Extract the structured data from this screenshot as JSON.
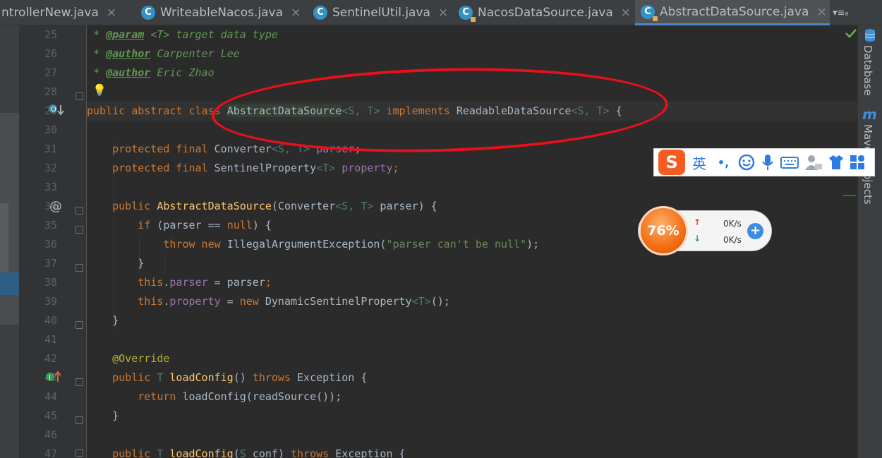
{
  "tabs": [
    {
      "label": "ntrollerNew.java",
      "icon": "",
      "close": "×"
    },
    {
      "label": "WriteableNacos.java",
      "icon": "C",
      "close": "×"
    },
    {
      "label": "SentinelUtil.java",
      "icon": "C",
      "close": "×"
    },
    {
      "label": "NacosDataSource.java",
      "icon": "C",
      "close": "×"
    },
    {
      "label": "AbstractDataSource.java",
      "icon": "C",
      "close": "×"
    }
  ],
  "tab_overflow": "▾≡₆",
  "line_numbers": [
    "25",
    "26",
    "27",
    "28",
    "29",
    "30",
    "31",
    "32",
    "33",
    "34",
    "35",
    "36",
    "37",
    "38",
    "39",
    "40",
    "41",
    "42",
    "43",
    "44",
    "45",
    "46",
    "47"
  ],
  "right_tools": {
    "database": "Database",
    "maven": "Maven Projects",
    "maven_icon": "m"
  },
  "ime": {
    "logo": "S",
    "lang": "英",
    "punct": "•,"
  },
  "speed": {
    "percent": "76%",
    "up": "0K/s",
    "down": "0K/s",
    "up_arrow": "↑",
    "down_arrow": "↓",
    "plus": "+"
  },
  "gutter_icons": {
    "bulb": "💡",
    "override_at": "@"
  },
  "colors": {
    "keyword": "#cc7832",
    "field": "#9876aa",
    "function": "#ffc66d",
    "string": "#6a8759",
    "doc": "#629755",
    "annotation": "#bbb529",
    "annotation_ring": "#e8101a",
    "ime_brand": "#f55b23"
  },
  "code": {
    "l25": {
      "p": " * ",
      "tag": "@param",
      "rest": " <T> target data type"
    },
    "l26": {
      "p": " * ",
      "tag": "@author",
      "rest": " Carpenter Lee"
    },
    "l27": {
      "p": " * ",
      "tag": "@author",
      "rest": " Eric Zhao"
    },
    "l29": {
      "k1": "public abstract class ",
      "name": "AbstractDataSource",
      "g1": "<S, T>",
      "k2": " implements ",
      "iface": "ReadableDataSource",
      "g2": "<S, T>",
      "end": " {"
    },
    "l31": {
      "k": "    protected final ",
      "ty": "Converter",
      "g": "<S, T>",
      "f": " parser",
      "end": ";"
    },
    "l32": {
      "k": "    protected final ",
      "ty": "SentinelProperty",
      "g": "<T>",
      "f": " property",
      "end": ";"
    },
    "l34": {
      "k": "    public ",
      "fn": "AbstractDataSource",
      "a": "(Converter",
      "g": "<S, T>",
      "b": " parser) {"
    },
    "l35": {
      "k": "        if ",
      "a": "(parser == ",
      "n": "null",
      "b": ") {"
    },
    "l36": {
      "k": "            throw new ",
      "a": "IllegalArgumentException(",
      "s": "\"parser can't be null\"",
      "b": ");"
    },
    "l37": {
      "a": "        }"
    },
    "l38": {
      "k": "        this",
      "d": ".",
      "f": "parser",
      "a": " = parser",
      ";": ";"
    },
    "l39": {
      "k": "        this",
      "d": ".",
      "f": "property",
      "a": " = ",
      "k2": "new ",
      "b": "DynamicSentinelProperty",
      "g": "<T>",
      "c": "();"
    },
    "l40": {
      "a": "    }"
    },
    "l42": {
      "ann": "    @Override"
    },
    "l43": {
      "k": "    public ",
      "g": "T ",
      "fn": "loadConfig",
      "a": "() ",
      "k2": "throws ",
      "b": "Exception {"
    },
    "l44": {
      "k": "        return ",
      "a": "loadConfig(readSource());"
    },
    "l45": {
      "a": "    }"
    },
    "l47": {
      "k": "    public ",
      "g": "T ",
      "fn": "loadConfig",
      "a": "(",
      "g2": "S ",
      "b": "conf) ",
      "k2": "throws ",
      "c": "Exception {"
    }
  }
}
